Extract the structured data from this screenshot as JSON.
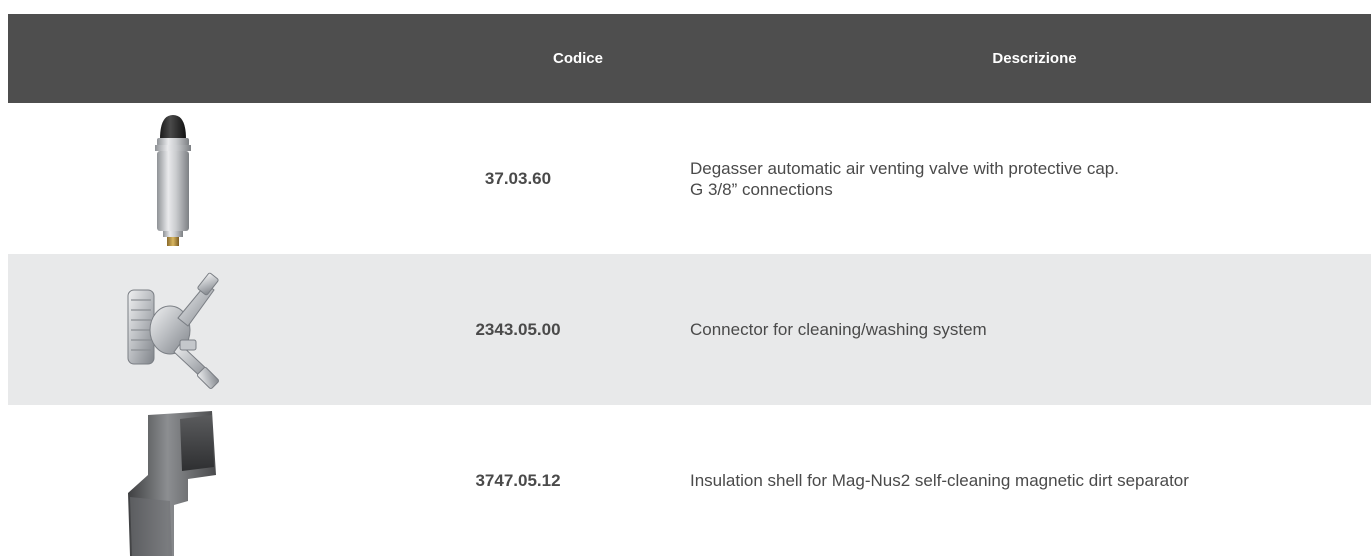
{
  "table": {
    "headers": {
      "code": "Codice",
      "description": "Descrizione"
    },
    "rows": [
      {
        "image_icon": "air-vent-valve-image",
        "code": "37.03.60",
        "description_line1": "Degasser automatic air venting valve with protective cap.",
        "description_line2": "G 3/8” connections"
      },
      {
        "image_icon": "cleaning-connector-image",
        "code": "2343.05.00",
        "description_line1": "Connector for cleaning/washing system",
        "description_line2": ""
      },
      {
        "image_icon": "insulation-shell-image",
        "code": "3747.05.12",
        "description_line1": "Insulation shell for Mag-Nus2 self-cleaning magnetic dirt separator",
        "description_line2": ""
      }
    ]
  },
  "colors": {
    "header_bg": "#4e4e4e",
    "alt_row_bg": "#e8e9ea",
    "text": "#4a4a4a"
  }
}
